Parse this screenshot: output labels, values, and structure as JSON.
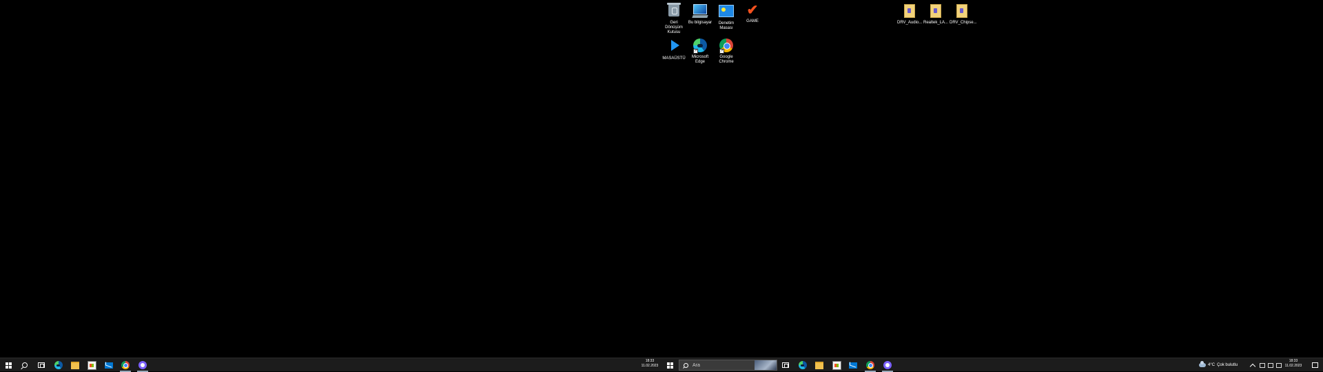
{
  "desktop": {
    "left_group": [
      {
        "label": "Geri Dönüşüm Kutusu",
        "icon": "recycle-bin-icon"
      },
      {
        "label": "Bu bilgisayar",
        "icon": "this-pc-icon"
      },
      {
        "label": "Denetim Masası",
        "icon": "control-panel-icon"
      },
      {
        "label": "GAME",
        "icon": "checkmark-icon"
      },
      {
        "label": "MASAÜSTÜ",
        "icon": "play-icon"
      },
      {
        "label": "Microsoft Edge",
        "icon": "edge-icon"
      },
      {
        "label": "Google Chrome",
        "icon": "chrome-icon"
      }
    ],
    "right_group": [
      {
        "label": "DRV_Audio...",
        "icon": "file-icon"
      },
      {
        "label": "Realtek_LA...",
        "icon": "file-icon"
      },
      {
        "label": "DRV_Chipse...",
        "icon": "file-icon"
      }
    ]
  },
  "taskbar_left": {
    "clock_time": "18:33",
    "clock_date": "11.02.2023",
    "apps": [
      "start-icon",
      "search-icon",
      "task-view-icon",
      "edge-icon",
      "file-explorer-icon",
      "store-icon",
      "mail-icon",
      "chrome-icon",
      "messenger-icon"
    ]
  },
  "taskbar_right": {
    "search_placeholder": "Ara",
    "weather_temp": "4°C",
    "weather_text": "Çok bulutlu",
    "clock_time": "18:33",
    "clock_date": "11.02.2023"
  },
  "colors": {
    "desktop_bg": "#000000",
    "taskbar_bg": "#1c1c1c",
    "accent": "#0078d4"
  }
}
